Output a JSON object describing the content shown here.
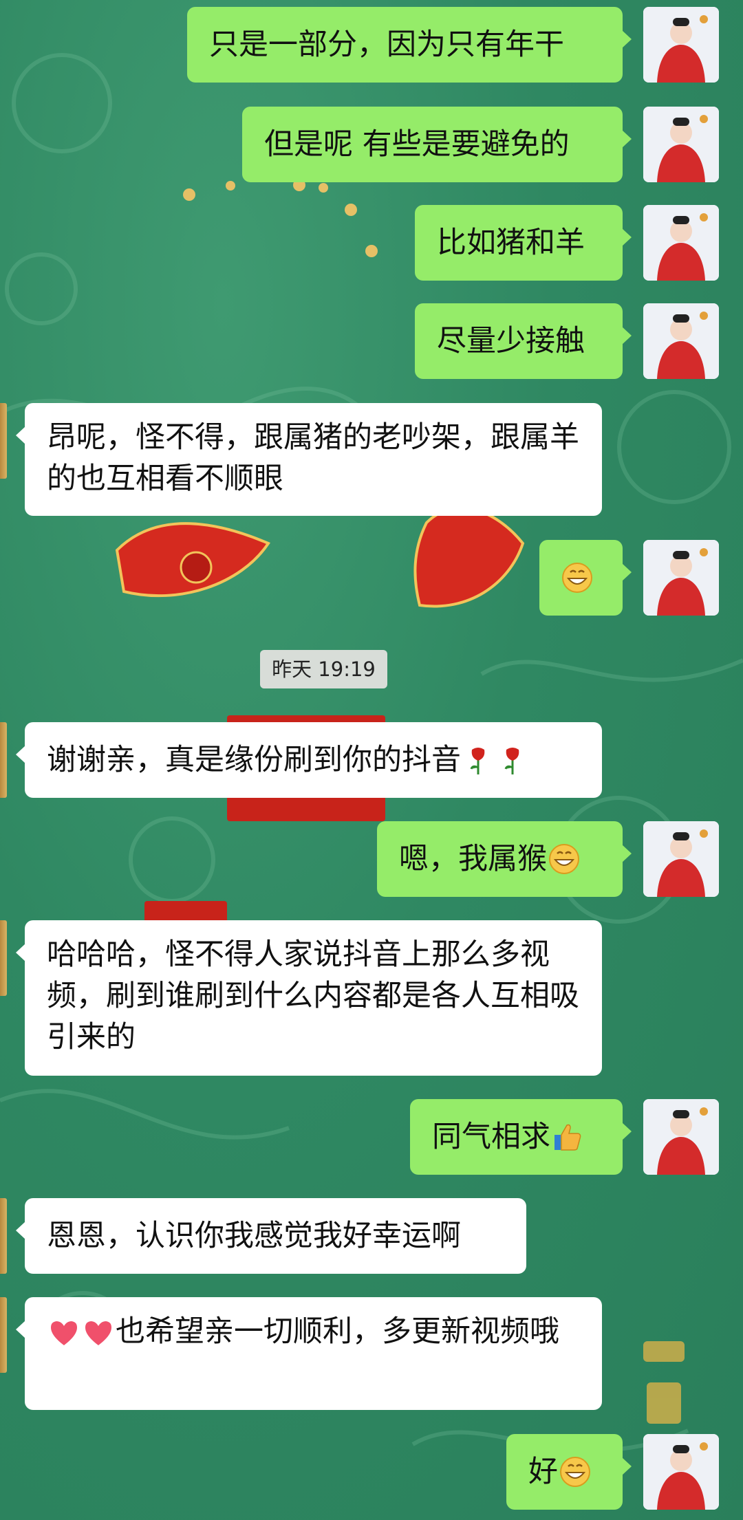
{
  "messages": [
    {
      "side": "out",
      "text": "只是一部分，因为只有年干"
    },
    {
      "side": "out",
      "text": "但是呢 有些是要避免的"
    },
    {
      "side": "out",
      "text": "比如猪和羊"
    },
    {
      "side": "out",
      "text": "尽量少接触"
    },
    {
      "side": "in",
      "text": "昂呢，怪不得，跟属猪的老吵架，跟属羊的也互相看不顺眼"
    },
    {
      "side": "out",
      "text": "",
      "emoji_after": "grin-emoji"
    },
    {
      "side": "in",
      "text": "谢谢亲，真是缘份刷到你的抖音",
      "emoji_after": "rose-emoji-x2"
    },
    {
      "side": "out",
      "text": "嗯，我属猴",
      "emoji_after": "grin-emoji"
    },
    {
      "side": "in",
      "text": "哈哈哈，怪不得人家说抖音上那么多视频，刷到谁刷到什么内容都是各人互相吸引来的"
    },
    {
      "side": "out",
      "text": "同气相求",
      "emoji_after": "thumbs-up-emoji"
    },
    {
      "side": "in",
      "text": "恩恩，认识你我感觉我好幸运啊"
    },
    {
      "side": "in",
      "text": "也希望亲一切顺利，多更新视频哦",
      "emoji_before": "heart-emoji-x2"
    },
    {
      "side": "out",
      "text": "好",
      "emoji_after": "grin-emoji"
    }
  ],
  "timestamp": "昨天 19:19",
  "colors": {
    "outgoing_bubble": "#95ec69",
    "incoming_bubble": "#ffffff",
    "background": "#2f8862",
    "timestamp_bg": "#d8ddd8"
  }
}
